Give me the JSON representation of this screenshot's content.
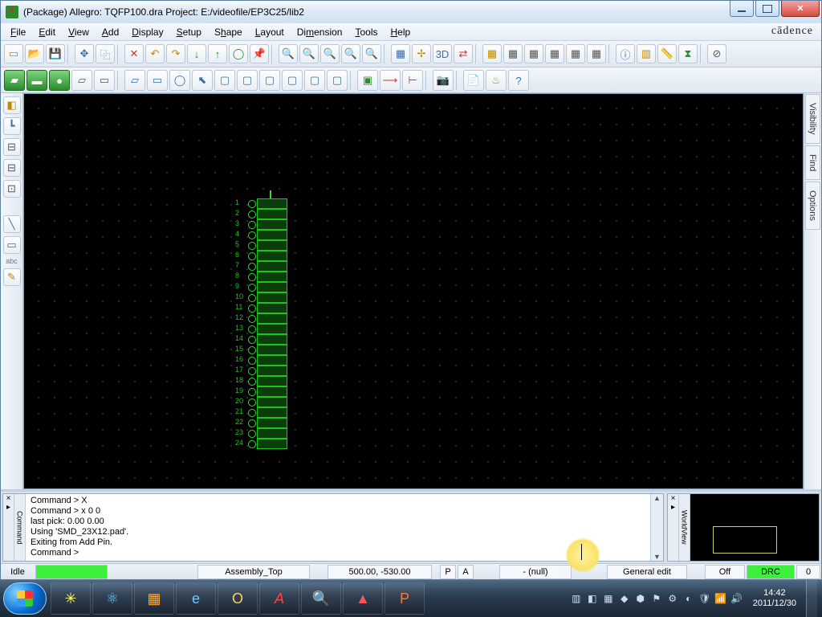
{
  "titlebar": {
    "title": "(Package) Allegro: TQFP100.dra  Project: E:/videofile/EP3C25/lib2"
  },
  "menu": {
    "items": [
      "File",
      "Edit",
      "View",
      "Add",
      "Display",
      "Setup",
      "Shape",
      "Layout",
      "Dimension",
      "Tools",
      "Help"
    ],
    "brand": "cādence"
  },
  "right_tabs": [
    "Visibility",
    "Find",
    "Options"
  ],
  "command": {
    "tab": "Command",
    "lines": [
      "Command > X",
      "Command > x 0 0",
      "last pick:  0.00  0.00",
      "Using 'SMD_23X12.pad'.",
      "Exiting from Add Pin.",
      "Command >"
    ]
  },
  "worldview": {
    "tab": "WorldView"
  },
  "status": {
    "mode": "Idle",
    "layer": "Assembly_Top",
    "coords": "500.00, -530.00",
    "p": "P",
    "a": "A",
    "net": "- (null)",
    "editmode": "General edit",
    "grid": "Off",
    "drc": "DRC",
    "count": "0"
  },
  "pin_count": 24,
  "taskbar": {
    "time": "14:42",
    "date": "2011/12/30"
  }
}
